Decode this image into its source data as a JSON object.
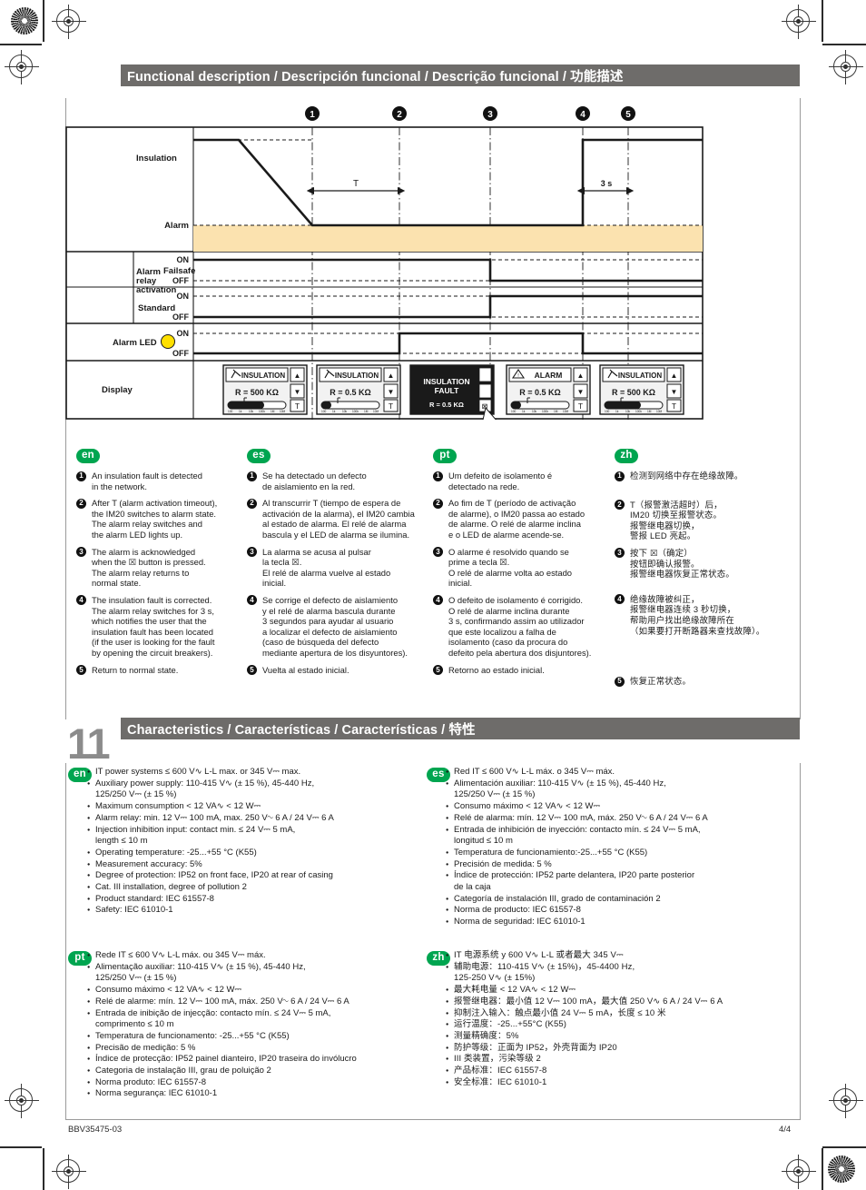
{
  "sections": {
    "functional": {
      "title_parts": [
        "Functional description",
        "Descripción funcional",
        "Descrição funcional"
      ],
      "title_cjk": "功能描述",
      "title_full": "Functional description / Descripción funcional / Descrição funcional / 功能描述"
    },
    "characteristics": {
      "number": "11",
      "title_parts": [
        "Characteristics",
        "Características",
        "Características"
      ],
      "title_cjk": "特性",
      "title_full": "Characteristics / Características / Características / 特性"
    }
  },
  "diagram": {
    "markers": [
      "1",
      "2",
      "3",
      "4",
      "5"
    ],
    "rows": {
      "insulation": {
        "label": "Insulation",
        "threshold_label": "Alarm"
      },
      "alarm_relay": {
        "label": "Alarm\nrelay\nactivation",
        "sub_rows": [
          {
            "label": "Failsafe",
            "states": [
              "ON",
              "OFF"
            ]
          },
          {
            "label": "Standard",
            "states": [
              "ON",
              "OFF"
            ]
          }
        ]
      },
      "alarm_led": {
        "label": "Alarm LED",
        "states": [
          "ON",
          "OFF"
        ],
        "led_color": "#FFE000"
      },
      "display": {
        "label": "Display"
      }
    },
    "annotations": [
      {
        "name": "alarm-timeout",
        "text": "T"
      },
      {
        "name": "relay-hold",
        "text": "3 s"
      }
    ],
    "screens": [
      {
        "title": "INSULATION",
        "icon": "insulation-icon",
        "value": "R = 500 KΩ",
        "bar_fill": 0.62,
        "marker": 0.36,
        "inverted": false,
        "buttons": [
          "▲",
          "▼",
          "T"
        ],
        "scale": [
          "100",
          "1k",
          "10k",
          "100k",
          "1M",
          "10M"
        ]
      },
      {
        "title": "INSULATION",
        "icon": "insulation-icon",
        "value": "R = 0.5 KΩ",
        "bar_fill": 0.12,
        "marker": 0.36,
        "inverted": false,
        "buttons": [
          "▲",
          "▼",
          "T"
        ],
        "scale": [
          "100",
          "1k",
          "10k",
          "100k",
          "1M",
          "10M"
        ]
      },
      {
        "title": "INSULATION\nFAULT",
        "icon": "none",
        "value": "R = 0.5 KΩ",
        "bar_fill": 0,
        "marker": 0,
        "inverted": true,
        "buttons": [
          "",
          "",
          "OK"
        ],
        "scale": []
      },
      {
        "title": "ALARM",
        "icon": "warning-icon",
        "value": "R = 0.5 KΩ",
        "bar_fill": 0.12,
        "marker": 0.36,
        "inverted": false,
        "buttons": [
          "▲",
          "▼",
          "T"
        ],
        "scale": [
          "100",
          "1k",
          "10k",
          "100k",
          "1M",
          "10M"
        ]
      },
      {
        "title": "INSULATION",
        "icon": "insulation-icon",
        "value": "R = 500 KΩ",
        "bar_fill": 0.62,
        "marker": 0.36,
        "inverted": false,
        "buttons": [
          "▲",
          "▼",
          "T"
        ],
        "scale": [
          "100",
          "1k",
          "10k",
          "100k",
          "1M",
          "10M"
        ]
      }
    ],
    "colors": {
      "alarm_band": "#FBE2AF",
      "line": "#1a1a1a"
    }
  },
  "steps": {
    "en": {
      "lang": "en",
      "items": [
        "An insulation fault is detected\nin the network.",
        "After T (alarm activation timeout),\nthe IM20 switches to alarm state.\nThe alarm relay switches and\nthe alarm LED lights up.",
        "The alarm is acknowledged\nwhen the ☒ button is pressed.\nThe alarm relay returns to\nnormal state.",
        "The insulation fault is corrected.\nThe alarm relay switches for 3 s,\nwhich notifies the user that the\ninsulation fault has been located\n(if the user is looking for the fault\nby opening the circuit breakers).",
        "Return to normal state."
      ]
    },
    "es": {
      "lang": "es",
      "items": [
        "Se ha detectado un defecto\nde aislamiento en la red.",
        "Al transcurrir T (tiempo de espera de\nactivación de la alarma), el IM20 cambia\nal estado de alarma. El relé de alarma\nbascula y el LED de alarma se ilumina.",
        "La alarma se acusa al pulsar\nla tecla ☒.\nEl relé de alarma vuelve al estado\ninicial.",
        "Se corrige el defecto de aislamiento\ny el relé de alarma bascula durante\n3 segundos para ayudar al usuario\na localizar el defecto de aislamiento\n(caso de búsqueda del defecto\nmediante apertura de los disyuntores).",
        "Vuelta al estado inicial."
      ]
    },
    "pt": {
      "lang": "pt",
      "items": [
        "Um defeito de isolamento é\ndetectado na rede.",
        "Ao fim de T (período de activação\nde alarme), o IM20 passa ao estado\nde alarme. O relé de alarme inclina\ne o LED de alarme acende-se.",
        "O alarme é resolvido quando se\nprime a tecla ☒.\nO relé de alarme volta ao estado\ninicial.",
        "O defeito de isolamento é corrigido.\nO relé de alarme inclina durante\n3 s, confirmando assim ao utilizador\nque este localizou a falha de\nisolamento (caso da procura do\ndefeito pela abertura dos disjuntores).",
        "Retorno ao estado inicial."
      ]
    },
    "zh": {
      "lang": "zh",
      "items": [
        "检测到网络中存在绝缘故障。",
        "T（报警激活超时）后，\nIM20 切换至报警状态。\n报警继电器切换，\n警报 LED 亮起。",
        "按下 ☒（确定）\n按钮即确认报警。\n报警继电器恢复正常状态。",
        "绝缘故障被纠正，\n报警继电器连续 3 秒切换，\n帮助用户找出绝缘故障所在\n（如果要打开断路器来查找故障）。",
        "恢复正常状态。"
      ]
    }
  },
  "characteristics": {
    "en": {
      "lang": "en",
      "items": [
        "IT power systems ≤ 600 V∿ L-L max. or 345 V⎓ max.",
        "Auxiliary power supply: 110-415 V∿ (± 15 %), 45-440 Hz,\n125/250 V⎓ (± 15 %)",
        "Maximum consumption < 12 VA∿  < 12 W⎓",
        "Alarm relay: min. 12 V⎓ 100 mA, max. 250 V∿ 6 A  / 24 V⎓ 6 A",
        "Injection inhibition input: contact min. ≤ 24 V⎓ 5 mA,\nlength ≤ 10 m",
        "Operating temperature: -25...+55 °C (K55)",
        "Measurement accuracy: 5%",
        "Degree of protection: IP52 on front face, IP20 at rear of casing",
        "Cat. III installation, degree of pollution 2",
        "Product standard: IEC 61557-8",
        "Safety: IEC 61010-1"
      ]
    },
    "es": {
      "lang": "es",
      "items": [
        "Red IT ≤ 600 V∿ L-L máx. o 345 V⎓ máx.",
        "Alimentación auxiliar: 110-415 V∿ (± 15 %), 45-440 Hz,\n125/250 V⎓ (± 15 %)",
        "Consumo máximo < 12 VA∿  < 12 W⎓",
        "Relé de alarma: mín. 12 V⎓ 100 mA, máx. 250 V∿ 6 A / 24 V⎓ 6 A",
        "Entrada de inhibición de inyección: contacto mín. ≤ 24 V⎓ 5 mA,\nlongitud ≤ 10 m",
        "Temperatura de funcionamiento:-25...+55 °C (K55)",
        "Precisión de medida: 5 %",
        "Índice de protección: IP52 parte delantera, IP20 parte posterior\nde la caja",
        "Categoría de instalación III, grado de contaminación 2",
        "Norma de producto: IEC 61557-8",
        "Norma de seguridad: IEC 61010-1"
      ]
    },
    "pt": {
      "lang": "pt",
      "items": [
        "Rede IT ≤ 600 V∿ L-L máx. ou 345 V⎓ máx.",
        "Alimentação auxiliar: 110-415 V∿ (± 15 %), 45-440 Hz,\n125/250 V⎓ (± 15 %)",
        "Consumo máximo < 12 VA∿  < 12 W⎓",
        "Relé de alarme: mín. 12 V⎓ 100 mA, máx. 250 V∿ 6 A / 24 V⎓ 6 A",
        "Entrada de inibição de injecção: contacto mín. ≤ 24 V⎓ 5 mA,\ncomprimento ≤ 10 m",
        "Temperatura de funcionamento: -25...+55 °C (K55)",
        "Precisão de medição: 5 %",
        "Índice de protecção: IP52 painel dianteiro, IP20 traseira do invólucro",
        "Categoria de instalação III, grau de poluição 2",
        "Norma produto: IEC 61557-8",
        "Norma segurança: IEC 61010-1"
      ]
    },
    "zh": {
      "lang": "zh",
      "items": [
        "IT 电源系统 y 600 V∿ L-L 或者最大 345 V⎓",
        "辅助电源：110-415 V∿ (± 15%)，45-4400 Hz,\n125-250 V∿ (± 15%)",
        "最大耗电量 < 12 VA∿ < 12 W⎓",
        "报警继电器：最小值 12 V⎓ 100 mA，最大值 250 V∿ 6 A / 24 V⎓ 6 A",
        "抑制注入输入：触点最小值 24 V⎓ 5 mA，长度 ≤ 10 米",
        "运行温度：-25...+55°C (K55)",
        "测量精确度：5%",
        "防护等级：正面为 IP52，外壳背面为 IP20",
        "III 类装置，污染等级 2",
        "产品标准：IEC 61557-8",
        "安全标准：IEC 61010-1"
      ]
    }
  },
  "footer": {
    "doc_number": "BBV35475-03",
    "page": "4/4"
  }
}
